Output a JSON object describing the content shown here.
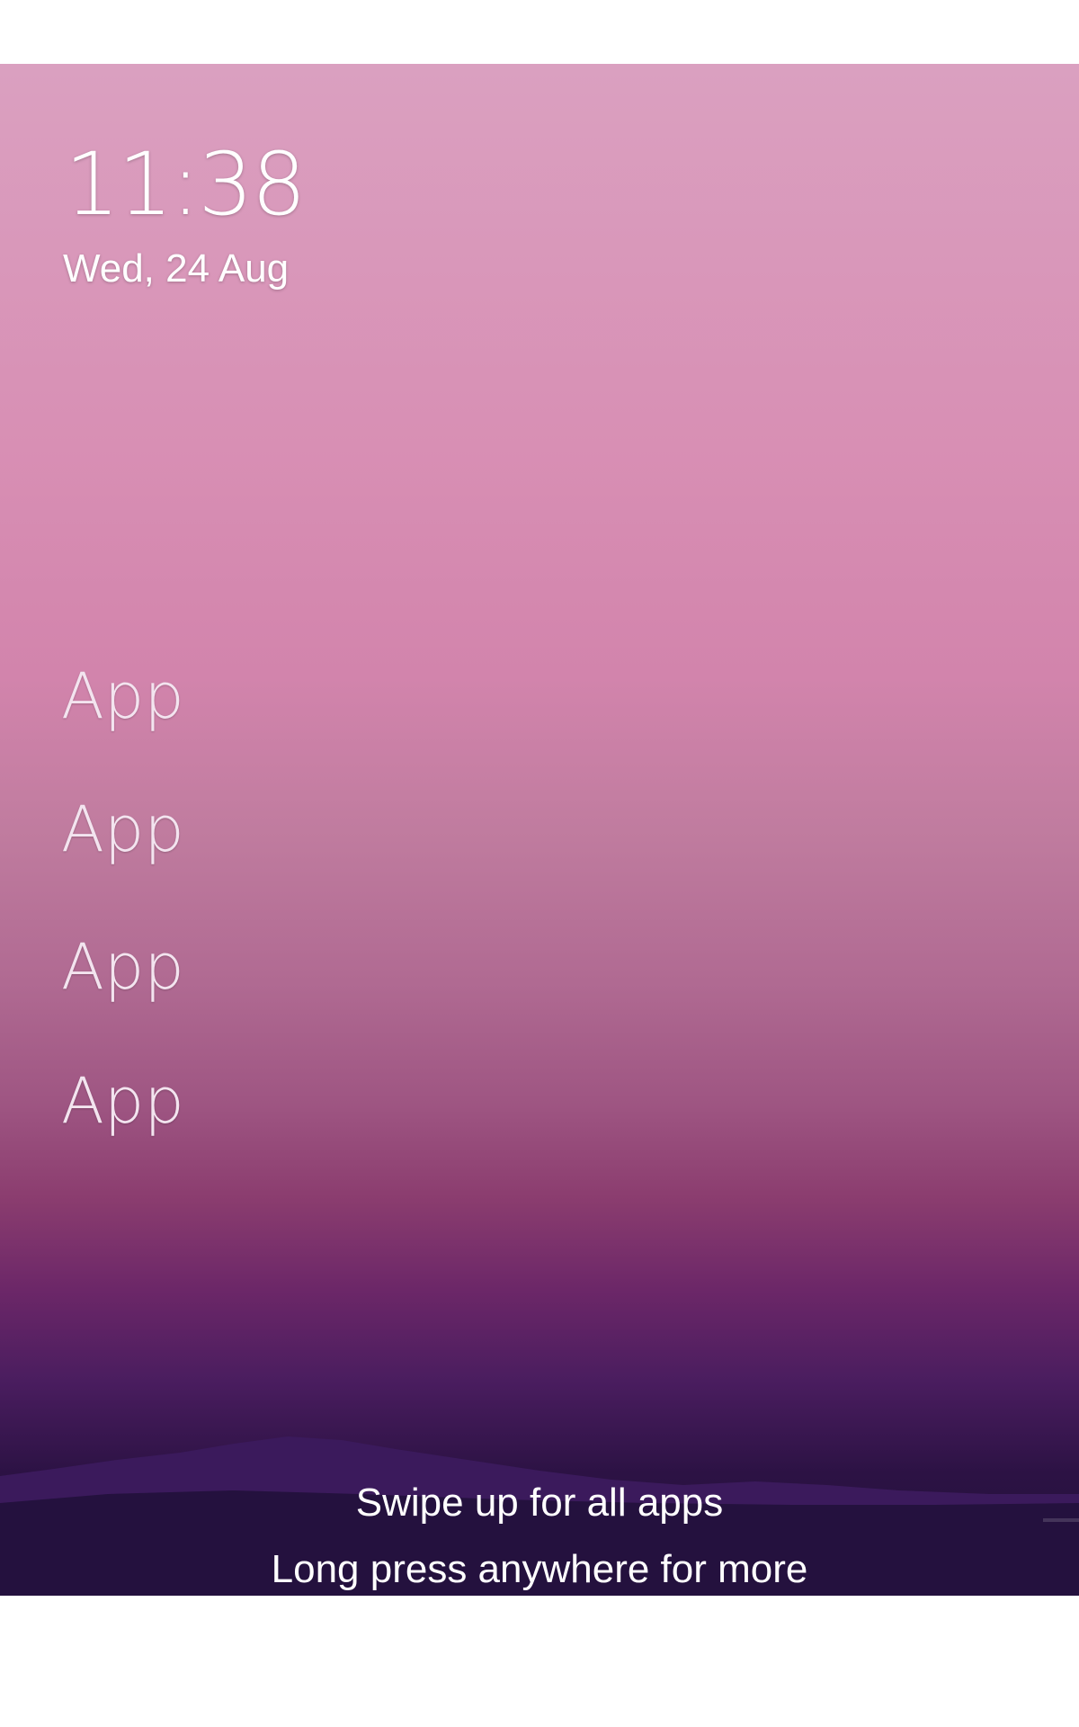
{
  "clock": {
    "time": "11:38",
    "date": "Wed, 24 Aug"
  },
  "apps": [
    {
      "label": "App"
    },
    {
      "label": "App"
    },
    {
      "label": "App"
    },
    {
      "label": "App"
    }
  ],
  "hints": {
    "swipe": "Swipe up for all apps",
    "long_press": "Long press anywhere for more"
  },
  "colors": {
    "text": "#ffffff",
    "wallpaper_top": "#daa0c0",
    "wallpaper_bottom": "#21113a"
  }
}
